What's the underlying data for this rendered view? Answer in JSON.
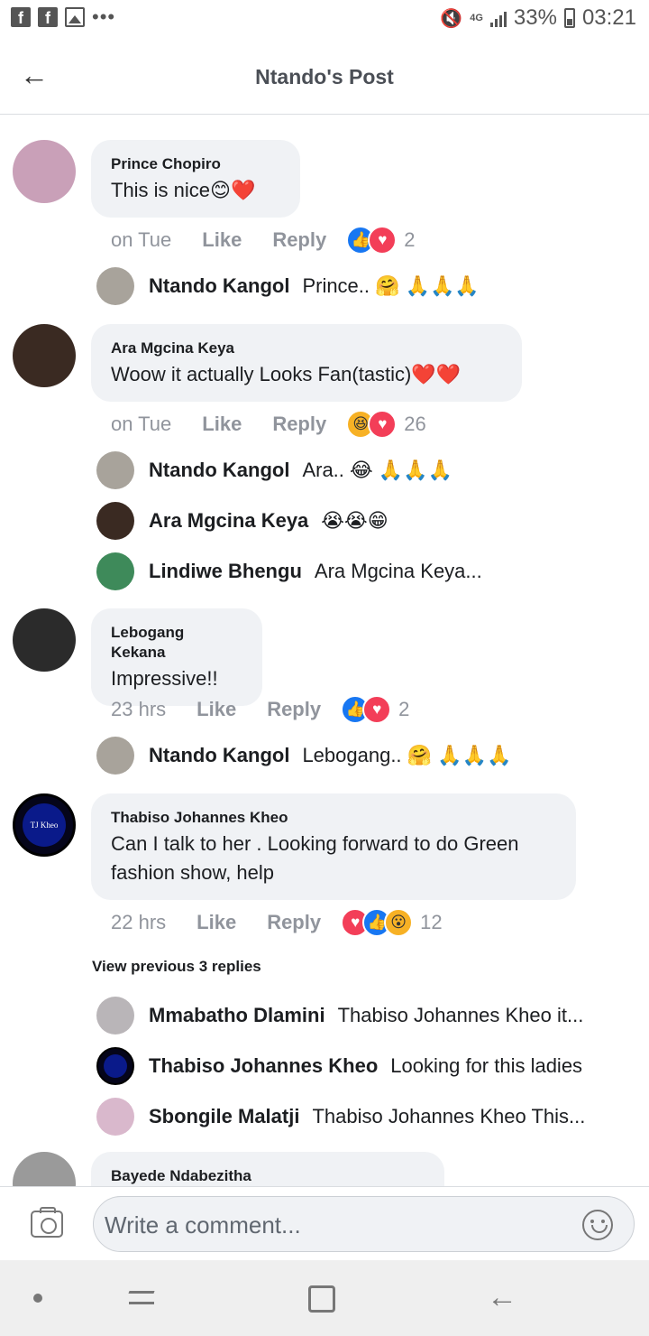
{
  "status_bar": {
    "network": "4G",
    "battery": "33%",
    "time": "03:21"
  },
  "header": {
    "title": "Ntando's Post"
  },
  "comments": [
    {
      "name": "Prince Chopiro",
      "text": "This is nice😊❤️",
      "time": "on Tue",
      "like_label": "Like",
      "reply_label": "Reply",
      "reactions": [
        "like",
        "love"
      ],
      "reaction_count": "2",
      "avatar_color": "#c9a0b8",
      "replies": [
        {
          "name": "Ntando Kangol",
          "text": "Prince.. 🤗 🙏🙏🙏",
          "avatar_color": "#a8a39b"
        }
      ]
    },
    {
      "name": "Ara Mgcina Keya",
      "text": "Woow it actually Looks Fan(tastic)❤️❤️",
      "time": "on Tue",
      "like_label": "Like",
      "reply_label": "Reply",
      "reactions": [
        "haha",
        "love"
      ],
      "reaction_count": "26",
      "avatar_color": "#3a2a22",
      "replies": [
        {
          "name": "Ntando Kangol",
          "text": "Ara.. 😂 🙏🙏🙏",
          "avatar_color": "#a8a39b"
        },
        {
          "name": "Ara Mgcina Keya",
          "text": "😭😭😁",
          "avatar_color": "#3a2a22"
        },
        {
          "name": "Lindiwe Bhengu",
          "text": "Ara Mgcina Keya...",
          "avatar_color": "#3e8a5a"
        }
      ]
    },
    {
      "name": "Lebogang Kekana",
      "text": "Impressive!!",
      "time": "23 hrs",
      "like_label": "Like",
      "reply_label": "Reply",
      "reactions": [
        "like",
        "love"
      ],
      "reaction_count": "2",
      "avatar_color": "#2b2b2b",
      "replies": [
        {
          "name": "Ntando Kangol",
          "text": "Lebogang.. 🤗 🙏🙏🙏",
          "avatar_color": "#a8a39b"
        }
      ]
    },
    {
      "name": "Thabiso Johannes Kheo",
      "text": "Can I talk to her . Looking forward to do Green fashion show, help",
      "time": "22 hrs",
      "like_label": "Like",
      "reply_label": "Reply",
      "reactions": [
        "love",
        "like",
        "wow"
      ],
      "reaction_count": "12",
      "avatar_color": "#05051a",
      "avatar_text": "TJ Kheo",
      "view_previous": "View previous 3 replies",
      "replies": [
        {
          "name": "Mmabatho Dlamini",
          "text": "Thabiso Johannes Kheo  it...",
          "avatar_color": "#b9b5b8"
        },
        {
          "name": "Thabiso Johannes Kheo",
          "text": "Looking for this ladies",
          "avatar_color": "#05051a"
        },
        {
          "name": "Sbongile Malatji",
          "text": "Thabiso Johannes Kheo This...",
          "avatar_color": "#d9b8cc"
        }
      ]
    },
    {
      "name": "Bayede Ndabezitha",
      "avatar_color": "#9a9a9a"
    }
  ],
  "composer": {
    "placeholder": "Write a comment..."
  }
}
